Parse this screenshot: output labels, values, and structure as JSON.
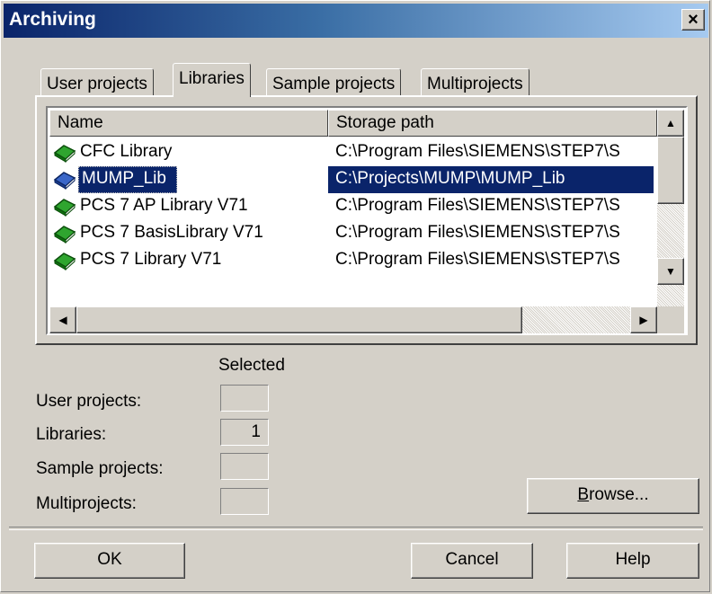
{
  "window": {
    "title": "Archiving",
    "close_glyph": "×"
  },
  "tabs": [
    {
      "label": "User projects",
      "active": false
    },
    {
      "label": "Libraries",
      "active": true
    },
    {
      "label": "Sample projects",
      "active": false
    },
    {
      "label": "Multiprojects",
      "active": false
    }
  ],
  "list": {
    "columns": [
      "Name",
      "Storage path"
    ],
    "rows": [
      {
        "name": "CFC Library",
        "path": "C:\\Program Files\\SIEMENS\\STEP7\\S",
        "icon": "library-book-icon",
        "selected": false
      },
      {
        "name": "MUMP_Lib",
        "path": "C:\\Projects\\MUMP\\MUMP_Lib",
        "icon": "library-book-icon",
        "selected": true
      },
      {
        "name": "PCS 7 AP Library V71",
        "path": "C:\\Program Files\\SIEMENS\\STEP7\\S",
        "icon": "library-book-icon",
        "selected": false
      },
      {
        "name": "PCS 7 BasisLibrary V71",
        "path": "C:\\Program Files\\SIEMENS\\STEP7\\S",
        "icon": "library-book-icon",
        "selected": false
      },
      {
        "name": "PCS 7 Library V71",
        "path": "C:\\Program Files\\SIEMENS\\STEP7\\S",
        "icon": "library-book-icon",
        "selected": false
      }
    ]
  },
  "summary": {
    "heading": "Selected",
    "items": [
      {
        "label": "User projects:",
        "value": ""
      },
      {
        "label": "Libraries:",
        "value": "1"
      },
      {
        "label": "Sample projects:",
        "value": ""
      },
      {
        "label": "Multiprojects:",
        "value": ""
      }
    ]
  },
  "buttons": {
    "browse_prefix": "B",
    "browse_rest": "rowse...",
    "ok": "OK",
    "cancel": "Cancel",
    "help": "Help"
  },
  "colors": {
    "selection": "#0a246a",
    "icon_green": "#1e8a1e",
    "icon_blue": "#2850b0"
  }
}
